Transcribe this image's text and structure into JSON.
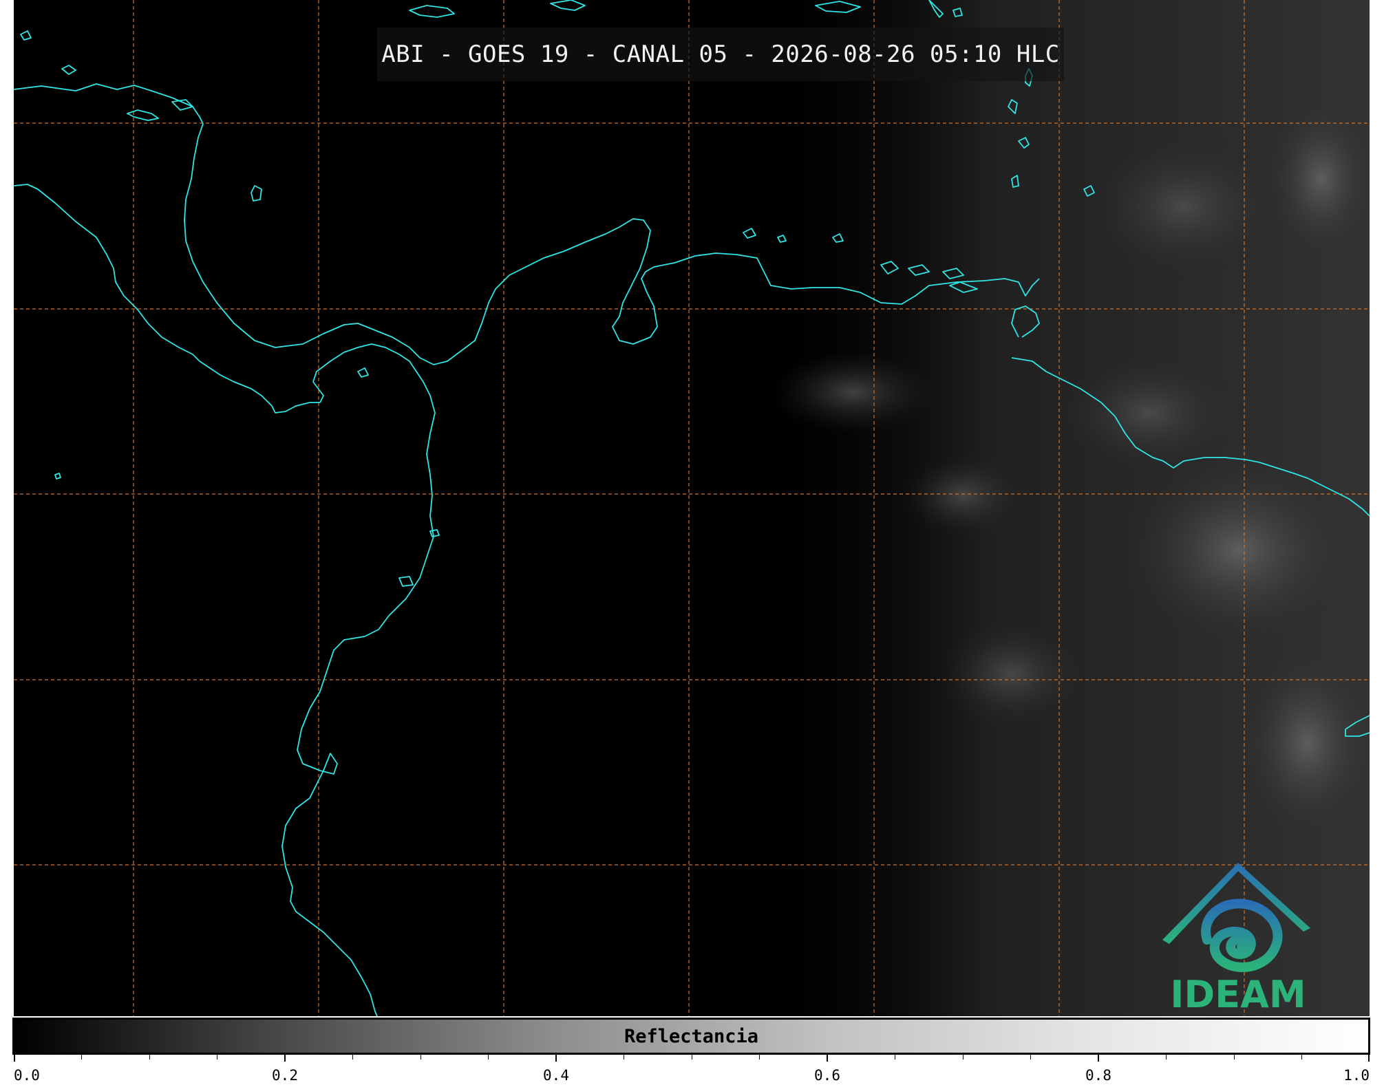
{
  "title": "ABI - GOES 19 - CANAL 05 - 2026-08-26 05:10 HLC",
  "colorbar": {
    "label": "Reflectancia",
    "ticks": [
      "0.0",
      "0.2",
      "0.4",
      "0.6",
      "0.8",
      "1.0"
    ],
    "range": [
      0.0,
      1.0
    ]
  },
  "logo": {
    "text": "IDEAM"
  },
  "colors": {
    "coastline": "#2fe6e6",
    "gridline": "#d0742c",
    "background": "#000000",
    "logo_blue": "#2a6fb5",
    "logo_green": "#2bb37a"
  }
}
